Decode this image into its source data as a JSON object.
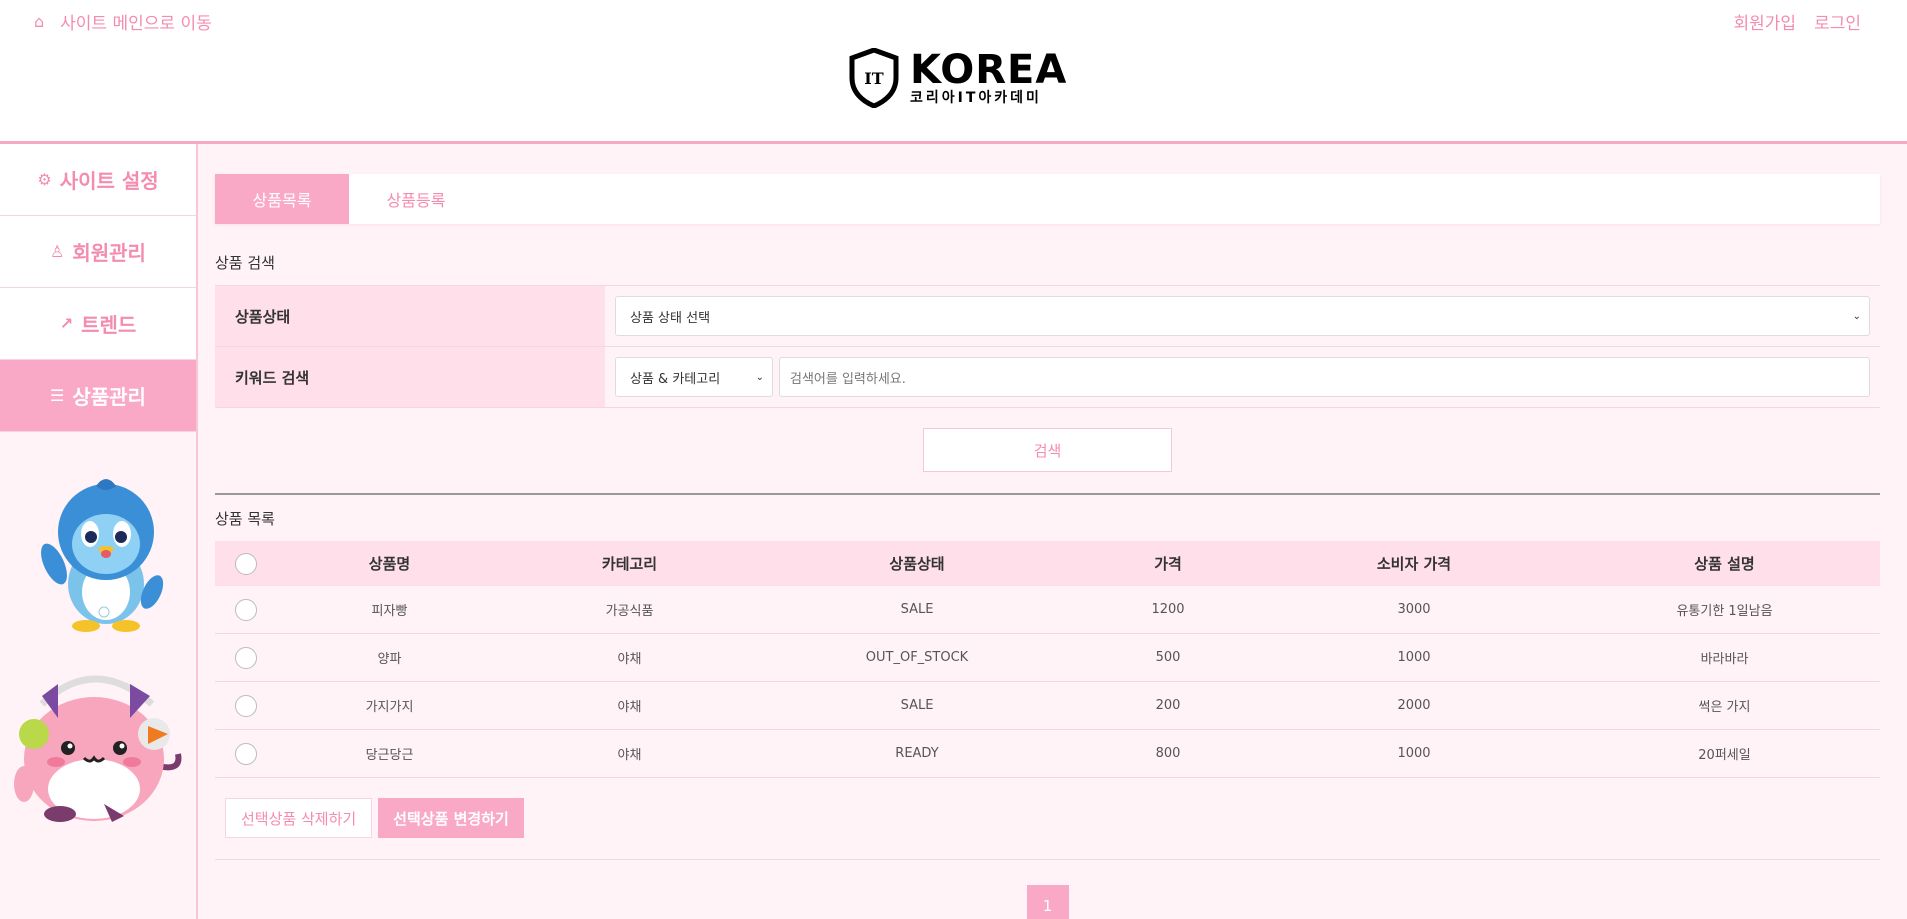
{
  "header": {
    "home_icon": "home-icon",
    "home_link": "사이트 메인으로 이동",
    "signup": "회원가입",
    "login": "로그인",
    "logo_main": "KOREA",
    "logo_sub": "코리아IT아카데미",
    "logo_badge": "IT"
  },
  "sidebar": {
    "items": [
      {
        "icon": "gear-icon",
        "label": "사이트 설정"
      },
      {
        "icon": "user-icon",
        "label": "회원관리"
      },
      {
        "icon": "trend-icon",
        "label": "트렌드"
      },
      {
        "icon": "list-icon",
        "label": "상품관리"
      }
    ]
  },
  "tabs": [
    {
      "label": "상품목록"
    },
    {
      "label": "상품등록"
    }
  ],
  "search": {
    "title": "상품 검색",
    "status_label": "상품상태",
    "status_select": "상품 상태 선택",
    "keyword_label": "키워드 검색",
    "keyword_select": "상품 & 카테고리",
    "keyword_placeholder": "검색어를 입력하세요.",
    "button": "검색"
  },
  "list": {
    "title": "상품 목록",
    "columns": [
      "상품명",
      "카테고리",
      "상품상태",
      "가격",
      "소비자 가격",
      "상품 설명"
    ],
    "rows": [
      {
        "name": "피자빵",
        "category": "가공식품",
        "status": "SALE",
        "price": "1200",
        "consumer_price": "3000",
        "desc": "유통기한 1일남음"
      },
      {
        "name": "양파",
        "category": "야채",
        "status": "OUT_OF_STOCK",
        "price": "500",
        "consumer_price": "1000",
        "desc": "바라바라"
      },
      {
        "name": "가지가지",
        "category": "야채",
        "status": "SALE",
        "price": "200",
        "consumer_price": "2000",
        "desc": "썩은 가지"
      },
      {
        "name": "당근당근",
        "category": "야채",
        "status": "READY",
        "price": "800",
        "consumer_price": "1000",
        "desc": "20퍼세일"
      }
    ],
    "delete_button": "선택상품 삭제하기",
    "change_button": "선택상품 변경하기",
    "page": "1"
  },
  "colors": {
    "accent": "#f9a9c6",
    "accent_text": "#f48cb1",
    "label_bg": "#ffe0ea",
    "page_bg": "#fff3f7"
  }
}
